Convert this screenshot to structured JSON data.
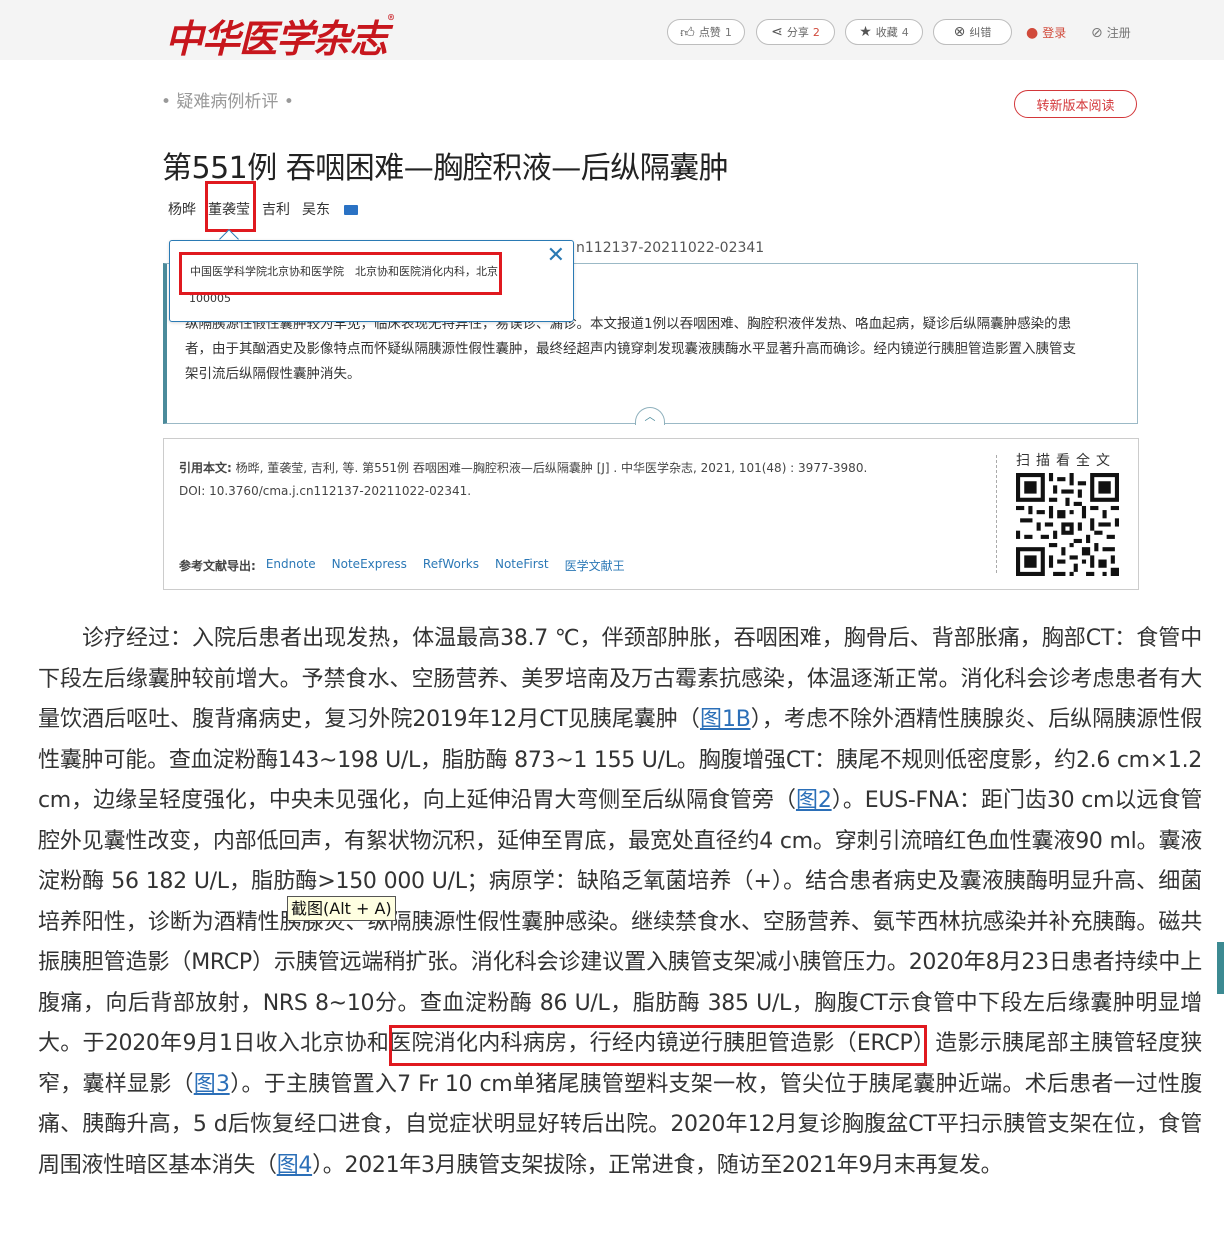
{
  "header": {
    "logo": "中华医学杂志",
    "toolbar": {
      "like": {
        "label": "点赞",
        "count": "1"
      },
      "share": {
        "label": "分享",
        "count": "2"
      },
      "favorite": {
        "label": "收藏",
        "count": "4"
      },
      "correct": {
        "label": "纠错"
      },
      "login": "登录",
      "register": "注册"
    }
  },
  "article": {
    "section": "• 疑难病例析评 •",
    "switch_button": "转新版本阅读",
    "title": "第551例 吞咽困难—胸腔积液—后纵隔囊肿",
    "authors": [
      "杨晔",
      "董袭莹",
      "吉利",
      "吴东"
    ],
    "doi_fragment": "n112137-20211022-02341",
    "affiliation_line1": "中国医学科学院北京协和医学院　北京协和医院消化内科，北京",
    "affiliation_line2": "100005",
    "abstract_line1": "纵隔胰源性假性囊肿较为罕见，临床表现无特异性，易误诊、漏诊。本文报道1例以吞咽困难、胸腔积液伴发热、咯血起病，疑诊后纵隔囊肿感染的患",
    "abstract_line2": "者，由于其酗酒史及影像特点而怀疑纵隔胰源性假性囊肿，最终经超声内镜穿刺发现囊液胰酶水平显著升高而确诊。经内镜逆行胰胆管造影置入胰管支",
    "abstract_line3": "架引流后纵隔假性囊肿消失。"
  },
  "citation": {
    "label": "引用本文:",
    "text": "杨晔, 董袭莹, 吉利, 等.  第551例 吞咽困难—胸腔积液—后纵隔囊肿 [J] . 中华医学杂志, 2021, 101(48) : 3977-3980.",
    "doi": "DOI: 10.3760/cma.j.cn112137-20211022-02341.",
    "export_label": "参考文献导出:",
    "export_links": [
      "Endnote",
      "NoteExpress",
      "RefWorks",
      "NoteFirst",
      "医学文献王"
    ],
    "scan_label": "扫描看全文"
  },
  "body": {
    "p1": "　　诊疗经过：入院后患者出现发热，体温最高38.7 ℃，伴颈部肿胀，吞咽困难，胸骨后、背部胀痛，胸部CT：食管中下段左后缘囊肿较前增大。予禁食水、空肠营养、美罗培南及万古霉素抗感染，体温逐渐正常。消化科会诊考虑患者有大量饮酒后呕吐、腹背痛病史，复习外院2019年12月CT见胰尾囊肿（",
    "link1": "图1B",
    "p2": "），考虑不除外酒精性胰腺炎、后纵隔胰源性假性囊肿可能。查血淀粉酶143~198 U/L，脂肪酶 873~1 155 U/L。胸腹增强CT：胰尾不规则低密度影，约2.6 cm×1.2 cm，边缘呈轻度强化，中央未见强化，向上延伸沿胃大弯侧至后纵隔食管旁（",
    "link2": "图2",
    "p3": "）。EUS-FNA：距门齿30 cm以远食管腔外见囊性改变，内部低回声，有絮状物沉积，延伸至胃底，最宽处直径约4 cm。穿刺引流暗红色血性囊液90 ml。囊液淀粉酶 56 182 U/L，脂肪酶>150 000 U/L；病原学：缺陷乏氧菌培养（+）。结合患者病史及囊液胰酶明显升高、细菌培养阳性，诊断为酒精性胰腺炎、纵隔胰源性假性囊肿感染。继续禁食水、空肠营养、氨苄西林抗感染并补充胰酶。磁共振胰胆管造影（MRCP）示胰管远端稍扩张。消化科会诊建议置入胰管支架减小胰管压力。2020年8月23日患者持续中上腹痛，向后背部放射，NRS 8~10分。查血淀粉酶 86 U/L，脂肪酶 385 U/L，胸腹CT示食管中下段左后缘囊肿明显增大。",
    "highlight": "于2020年9月1日收入北京协和医院消化内科病房，",
    "p4": "行经内镜逆行胰胆管造影（ERCP）造影示胰尾部主胰管轻度狭窄，囊样显影（",
    "link3": "图3",
    "p5": "）。于主胰管置入7 Fr 10 cm单猪尾胰管塑料支架一枚，管尖位于胰尾囊肿近端。术后患者一过性腹痛、胰酶升高，5 d后恢复经口进食，自觉症状明显好转后出院。2020年12月复诊胸腹盆CT平扫示胰管支架在位，食管周围液性暗区基本消失（",
    "link4": "图4",
    "p6": "）。2021年3月胰管支架拔除，正常进食，随访至2021年9月末再复发。",
    "tooltip": "截图(Alt + A)"
  }
}
